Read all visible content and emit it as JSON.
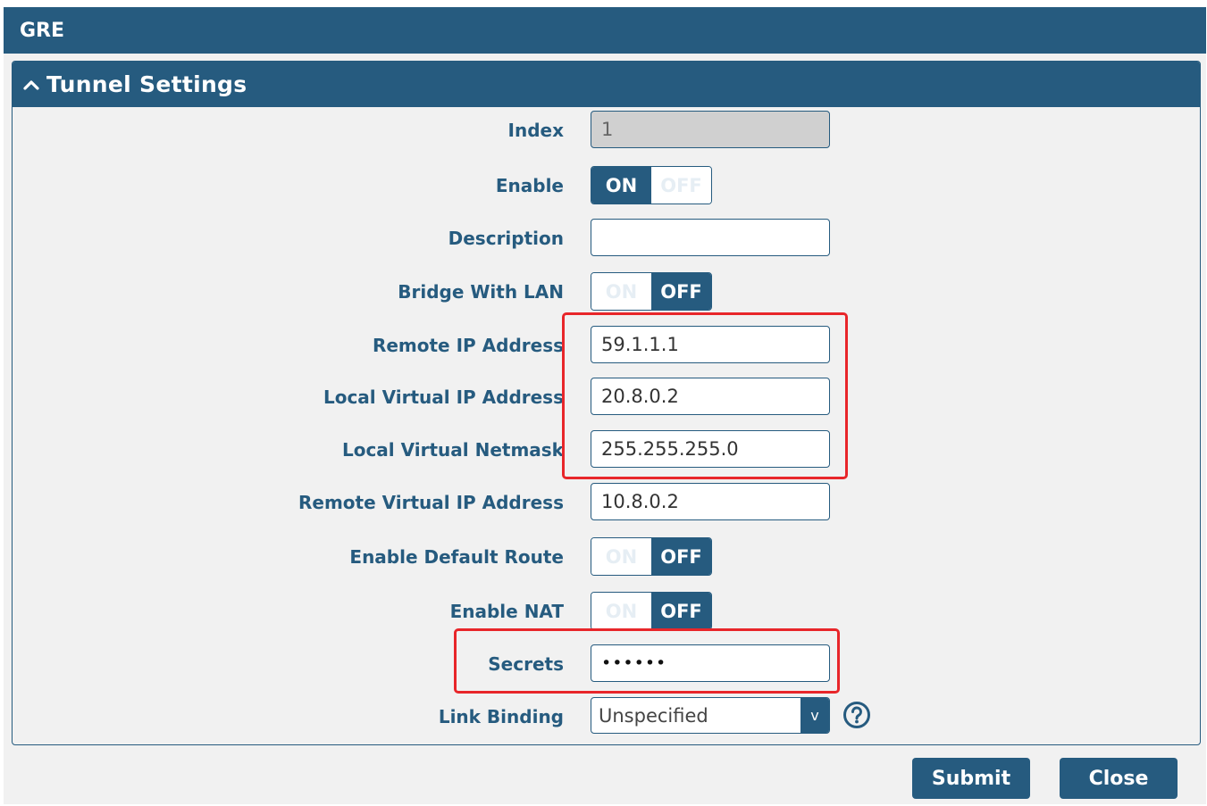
{
  "window": {
    "title": "GRE"
  },
  "section": {
    "title": "Tunnel Settings"
  },
  "form": {
    "index": {
      "label": "Index",
      "value": "1"
    },
    "enable": {
      "label": "Enable",
      "on_label": "ON",
      "off_label": "OFF",
      "state": "on"
    },
    "description": {
      "label": "Description",
      "value": ""
    },
    "bridge_with_lan": {
      "label": "Bridge With LAN",
      "on_label": "ON",
      "off_label": "OFF",
      "state": "off"
    },
    "remote_ip": {
      "label": "Remote IP Address",
      "value": "59.1.1.1"
    },
    "local_virtual_ip": {
      "label": "Local Virtual IP Address",
      "value": "20.8.0.2"
    },
    "local_virtual_netmask": {
      "label": "Local Virtual Netmask",
      "value": "255.255.255.0"
    },
    "remote_virtual_ip": {
      "label": "Remote Virtual IP Address",
      "value": "10.8.0.2"
    },
    "enable_default_route": {
      "label": "Enable Default Route",
      "on_label": "ON",
      "off_label": "OFF",
      "state": "off"
    },
    "enable_nat": {
      "label": "Enable NAT",
      "on_label": "ON",
      "off_label": "OFF",
      "state": "off"
    },
    "secrets": {
      "label": "Secrets",
      "value": "••••••"
    },
    "link_binding": {
      "label": "Link Binding",
      "value": "Unspecified",
      "arrow": "v"
    }
  },
  "buttons": {
    "submit": "Submit",
    "close": "Close"
  },
  "colors": {
    "primary": "#265b7f",
    "highlight": "#e8262a",
    "background": "#f1f1f1"
  }
}
